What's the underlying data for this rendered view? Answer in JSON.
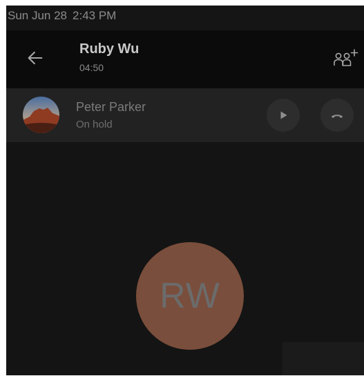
{
  "status_bar": {
    "date": "Sun Jun 28",
    "time": "2:43 PM"
  },
  "call_header": {
    "back_icon": "arrow-left-icon",
    "contact_name": "Ruby Wu",
    "duration": "04:50",
    "add_participant_icon": "add-person-icon"
  },
  "held_call": {
    "avatar_icon": "desert-landscape-photo",
    "name": "Peter Parker",
    "status": "On hold",
    "resume_icon": "play-icon",
    "end_icon": "hang-up-icon"
  },
  "active_call": {
    "avatar_initials": "RW",
    "avatar_color": "#7a4e3c"
  },
  "colors": {
    "screen_background": "#141414",
    "header_background": "#0b0b0b",
    "held_row_background": "#222222"
  }
}
